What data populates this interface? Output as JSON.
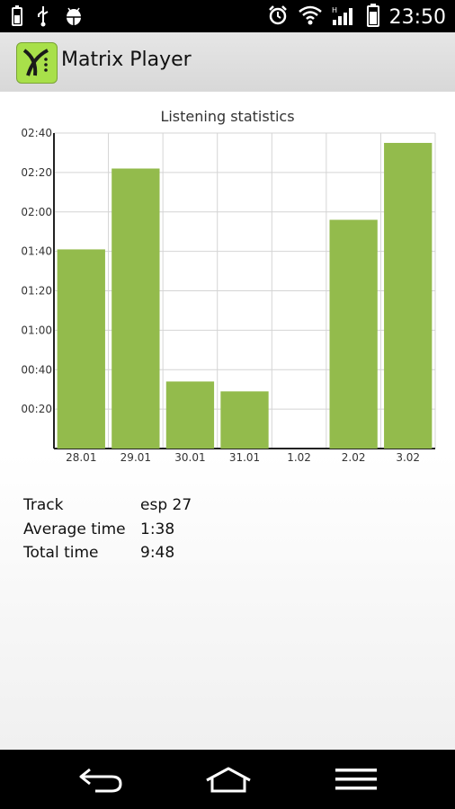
{
  "status_bar": {
    "time": "23:50",
    "left_icons": [
      "battery-saver-icon",
      "usb-icon",
      "android-debug-icon"
    ],
    "right_icons": [
      "alarm-icon",
      "wifi-icon",
      "signal-icon",
      "battery-icon"
    ]
  },
  "action_bar": {
    "app_icon": "matrix-player-logo",
    "title": "Matrix Player"
  },
  "stats": {
    "track_label": "Track",
    "track_value": "esp 27",
    "avg_label": "Average time",
    "avg_value": "1:38",
    "total_label": "Total time",
    "total_value": "9:48"
  },
  "nav_bar": {
    "icons": [
      "back-icon",
      "home-icon",
      "menu-icon"
    ]
  },
  "colors": {
    "bar": "#93bb4c",
    "grid": "#d4d4d4"
  },
  "chart_data": {
    "type": "bar",
    "title": "Listening statistics",
    "categories": [
      "28.01",
      "29.01",
      "30.01",
      "31.01",
      "1.02",
      "2.02",
      "3.02"
    ],
    "values": [
      101,
      142,
      34,
      29,
      0,
      116,
      155
    ],
    "value_unit": "minutes",
    "y_tick_labels": [
      "00:20",
      "00:40",
      "01:00",
      "01:20",
      "01:40",
      "02:00",
      "02:20",
      "02:40"
    ],
    "y_tick_values": [
      20,
      40,
      60,
      80,
      100,
      120,
      140,
      160
    ],
    "ylim": [
      0,
      160
    ],
    "xlabel": "",
    "ylabel": "",
    "grid": true
  }
}
